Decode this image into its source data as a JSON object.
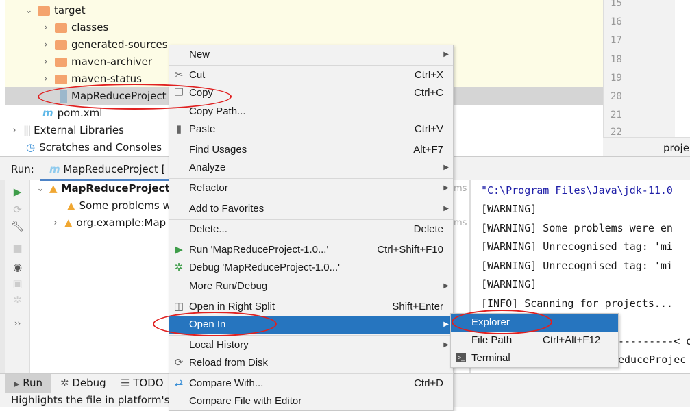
{
  "project_tree": {
    "items": [
      {
        "label": "target",
        "expanded": true
      },
      {
        "label": "classes"
      },
      {
        "label": "generated-sources"
      },
      {
        "label": "maven-archiver"
      },
      {
        "label": "maven-status"
      },
      {
        "label": "MapReduceProject",
        "selected": true
      },
      {
        "label": "pom.xml"
      },
      {
        "label": "External Libraries"
      },
      {
        "label": "Scratches and Consoles"
      }
    ]
  },
  "editor": {
    "line_numbers": [
      "15",
      "16",
      "17",
      "18",
      "19",
      "20",
      "21",
      "22"
    ],
    "tab_fragment": "proje"
  },
  "run_panel": {
    "label": "Run:",
    "tab": "MapReduceProject [",
    "tree": [
      {
        "label": "MapReduceProject",
        "bold": true
      },
      {
        "label": "Some problems w"
      },
      {
        "label": "org.example:Map"
      }
    ],
    "timings": [
      "ms",
      "ms"
    ]
  },
  "console": {
    "lines": [
      "\"C:\\Program Files\\Java\\jdk-11.0",
      "[WARNING]",
      "[WARNING] Some problems were en",
      "[WARNING] Unrecognised tag: 'mi",
      "[WARNING] Unrecognised tag: 'mi",
      "[WARNING]",
      "[INFO] Scanning for projects...",
      "",
      "---------< or",
      "educeProjec"
    ],
    "colors": {
      "first_line": "#1f1fa8"
    }
  },
  "bottom_tabs": [
    "Run",
    "Debug",
    "TODO"
  ],
  "status_bar": {
    "text": "Highlights the file in platform's f"
  },
  "context_menu": {
    "items": [
      {
        "label": "New",
        "submenu": true
      },
      {
        "label": "Cut",
        "shortcut": "Ctrl+X",
        "icon": "scissors-icon"
      },
      {
        "label": "Copy",
        "shortcut": "Ctrl+C",
        "icon": "copy-icon"
      },
      {
        "label": "Copy Path..."
      },
      {
        "label": "Paste",
        "shortcut": "Ctrl+V",
        "icon": "clipboard-icon"
      },
      {
        "label": "Find Usages",
        "shortcut": "Alt+F7"
      },
      {
        "label": "Analyze",
        "submenu": true
      },
      {
        "label": "Refactor",
        "submenu": true
      },
      {
        "label": "Add to Favorites",
        "submenu": true
      },
      {
        "label": "Delete...",
        "shortcut": "Delete"
      },
      {
        "label": "Run 'MapReduceProject-1.0...'",
        "shortcut": "Ctrl+Shift+F10",
        "icon": "run-icon"
      },
      {
        "label": "Debug 'MapReduceProject-1.0...'",
        "icon": "bug-icon"
      },
      {
        "label": "More Run/Debug",
        "submenu": true
      },
      {
        "label": "Open in Right Split",
        "shortcut": "Shift+Enter",
        "icon": "split-icon"
      },
      {
        "label": "Open In",
        "submenu": true,
        "highlighted": true
      },
      {
        "label": "Local History",
        "submenu": true
      },
      {
        "label": "Reload from Disk",
        "icon": "reload-icon"
      },
      {
        "label": "Compare With...",
        "shortcut": "Ctrl+D",
        "icon": "compare-icon"
      },
      {
        "label": "Compare File with Editor"
      }
    ]
  },
  "open_in_submenu": {
    "items": [
      {
        "label": "Explorer",
        "highlighted": true
      },
      {
        "label": "File Path",
        "shortcut": "Ctrl+Alt+F12"
      },
      {
        "label": "Terminal",
        "icon": "terminal-icon"
      }
    ]
  },
  "colors": {
    "highlight": "#2675bf",
    "annotation": "#e02020",
    "warning": "#f0a732"
  }
}
